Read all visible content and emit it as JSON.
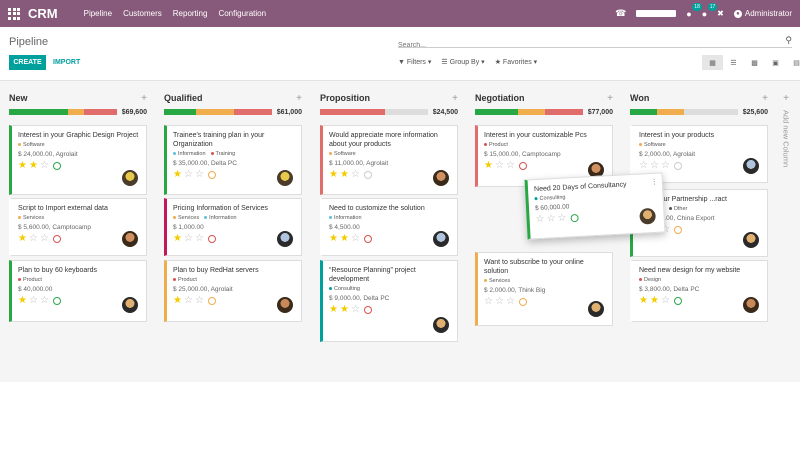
{
  "app": {
    "brand": "CRM",
    "nav": [
      "Pipeline",
      "Customers",
      "Reporting",
      "Configuration"
    ],
    "badges": [
      "18",
      "17"
    ],
    "user": "Administrator"
  },
  "control": {
    "title": "Pipeline",
    "search_placeholder": "Search...",
    "create_label": "CREATE",
    "import_label": "IMPORT",
    "filters_label": "Filters",
    "groupby_label": "Group By",
    "favorites_label": "Favorites"
  },
  "colors": {
    "brand": "#875a7b",
    "accent": "#00a09d",
    "green": "#28a745",
    "orange": "#f0ad4e",
    "red": "#e06c6c"
  },
  "add_column_label": "Add new Column",
  "columns": [
    {
      "title": "New",
      "total": "$69,600",
      "progress": {
        "green": 0.55,
        "orange": 0.15,
        "red": 0.3,
        "grey": 0
      },
      "cards": [
        {
          "title": "Interest in your Graphic Design Project",
          "tags": [
            {
              "label": "Software",
              "color": "#f0ad4e"
            }
          ],
          "amount": "$ 24,000.00, Agrolait",
          "stars": 2,
          "activity": "green",
          "border": "#28a745",
          "avatar": [
            "#e6c84a",
            "#4a3b2a"
          ]
        },
        {
          "title": "Script to Import external data",
          "tags": [
            {
              "label": "Services",
              "color": "#f0ad4e"
            }
          ],
          "amount": "$ 5,600.00, Camptocamp",
          "stars": 1,
          "activity": "red",
          "border": "#ffffff",
          "avatar": [
            "#d09060",
            "#3a2a1a"
          ]
        },
        {
          "title": "Plan to buy 60 keyboards",
          "tags": [
            {
              "label": "Product",
              "color": "#d9534f"
            }
          ],
          "amount": "$ 40,000.00",
          "stars": 1,
          "activity": "green",
          "border": "#28a745",
          "avatar": [
            "#e0b070",
            "#2a2a2a"
          ]
        }
      ]
    },
    {
      "title": "Qualified",
      "total": "$61,000",
      "progress": {
        "green": 0.3,
        "orange": 0.35,
        "red": 0.35,
        "grey": 0
      },
      "cards": [
        {
          "title": "Trainee's training plan in your Organization",
          "tags": [
            {
              "label": "Information",
              "color": "#5bc0de"
            },
            {
              "label": "Training",
              "color": "#d9534f"
            }
          ],
          "amount": "$ 35,000.00, Delta PC",
          "stars": 1,
          "activity": "orange",
          "border": "#28a745",
          "avatar": [
            "#e6c84a",
            "#4a3b2a"
          ]
        },
        {
          "title": "Pricing Information of Services",
          "tags": [
            {
              "label": "Services",
              "color": "#f0ad4e"
            },
            {
              "label": "Information",
              "color": "#5bc0de"
            }
          ],
          "amount": "$ 1,000.00",
          "stars": 1,
          "activity": "red",
          "border": "#c2185b",
          "avatar": [
            "#b0c4de",
            "#2a2a2a"
          ]
        },
        {
          "title": "Plan to buy RedHat servers",
          "tags": [
            {
              "label": "Product",
              "color": "#d9534f"
            }
          ],
          "amount": "$ 25,000.00, Agrolait",
          "stars": 1,
          "activity": "orange",
          "border": "#f0ad4e",
          "avatar": [
            "#c98a5a",
            "#3a2a1a"
          ]
        }
      ]
    },
    {
      "title": "Proposition",
      "total": "$24,500",
      "progress": {
        "green": 0,
        "orange": 0,
        "red": 0.6,
        "grey": 0.4
      },
      "cards": [
        {
          "title": "Would appreciate more information about your products",
          "tags": [
            {
              "label": "Software",
              "color": "#f0ad4e"
            }
          ],
          "amount": "$ 11,000.00, Agrolait",
          "stars": 2,
          "activity": "grey",
          "border": "#e06c6c",
          "avatar": [
            "#d09060",
            "#3a2a1a"
          ]
        },
        {
          "title": "Need to customize the solution",
          "tags": [
            {
              "label": "Information",
              "color": "#5bc0de"
            }
          ],
          "amount": "$ 4,500.00",
          "stars": 2,
          "activity": "red",
          "border": "#ffffff",
          "avatar": [
            "#b0c4de",
            "#2a2a2a"
          ]
        },
        {
          "title": "“Resource Planning” project development",
          "tags": [
            {
              "label": "Consulting",
              "color": "#00a09d"
            }
          ],
          "amount": "$ 9,000.00, Delta PC",
          "stars": 2,
          "activity": "red",
          "border": "#00a09d",
          "avatar": [
            "#e0b070",
            "#2a2a2a"
          ]
        }
      ]
    },
    {
      "title": "Negotiation",
      "total": "$77,000",
      "progress": {
        "green": 0.4,
        "orange": 0.25,
        "red": 0.35,
        "grey": 0
      },
      "cards": [
        {
          "title": "Interest in your customizable Pcs",
          "tags": [
            {
              "label": "Product",
              "color": "#d9534f"
            }
          ],
          "amount": "$ 15,000.00, Camptocamp",
          "stars": 1,
          "activity": "red",
          "border": "#e06c6c",
          "avatar": [
            "#d09060",
            "#3a2a1a"
          ]
        },
        {
          "title": "Want to subscribe to your online solution",
          "tags": [
            {
              "label": "Services",
              "color": "#f0ad4e"
            }
          ],
          "amount": "$ 2,000.00, Think Big",
          "stars": 0,
          "activity": "orange",
          "border": "#f0ad4e",
          "avatar": [
            "#e0b070",
            "#2a2a2a"
          ]
        }
      ]
    },
    {
      "title": "Won",
      "total": "$25,600",
      "progress": {
        "green": 0.25,
        "orange": 0.25,
        "red": 0,
        "grey": 0.5
      },
      "cards": [
        {
          "title": "Interest in your products",
          "tags": [
            {
              "label": "Software",
              "color": "#f0ad4e"
            }
          ],
          "amount": "$ 2,000.00, Agrolait",
          "stars": 0,
          "activity": "grey",
          "border": "#ffffff",
          "avatar": [
            "#b0c4de",
            "#2a2a2a"
          ]
        },
        {
          "title": "...t in your Partnership ...ract",
          "tags": [
            {
              "label": "...nation",
              "color": "#5bc0de"
            },
            {
              "label": "Other",
              "color": "#555555"
            }
          ],
          "amount": "$ 19,800.00, China Export",
          "stars": 2,
          "activity": "orange",
          "border": "#28a745",
          "avatar": [
            "#e0b070",
            "#2a2a2a"
          ]
        },
        {
          "title": "Need new design for my website",
          "tags": [
            {
              "label": "Design",
              "color": "#d9534f"
            }
          ],
          "amount": "$ 3,800.00, Delta PC",
          "stars": 2,
          "activity": "green",
          "border": "#ffffff",
          "avatar": [
            "#c98a5a",
            "#3a2a1a"
          ]
        }
      ]
    }
  ],
  "dragged_card": {
    "title": "Need 20 Days of Consultancy",
    "tags": [
      {
        "label": "Consulting",
        "color": "#00a09d"
      }
    ],
    "amount": "$ 60,000.00",
    "stars": 0,
    "activity": "green",
    "avatar": [
      "#e0b070",
      "#4a3b2a"
    ]
  }
}
